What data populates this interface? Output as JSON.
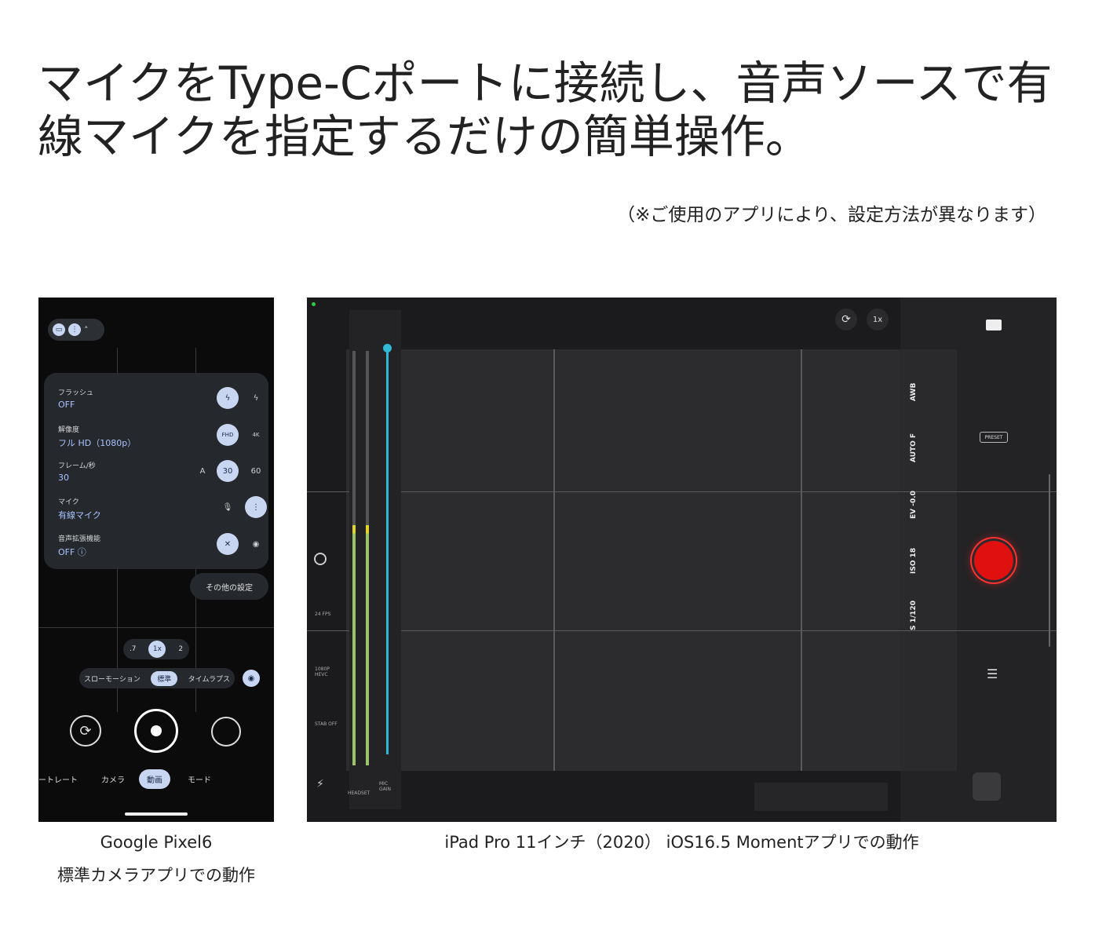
{
  "headline": "マイクをType-Cポートに接続し、音声ソースで有線マイクを指定するだけの簡単操作。",
  "note": "（※ご使用のアプリにより、設定方法が異なります）",
  "captions": {
    "pixel_line1": "Google Pixel6",
    "pixel_line2": "標準カメラアプリでの動作",
    "ipad": "iPad Pro 11インチ（2020） iOS16.5 Momentアプリでの動作"
  },
  "pixel": {
    "settings": [
      {
        "label": "フラッシュ",
        "value": "OFF"
      },
      {
        "label": "解像度",
        "value": "フル HD（1080p）"
      },
      {
        "label": "フレーム/秒",
        "value": "30"
      },
      {
        "label": "マイク",
        "value": "有線マイク"
      },
      {
        "label": "音声拡張機能",
        "value": "OFF ⓘ"
      }
    ],
    "fps_options": [
      "A",
      "30",
      "60"
    ],
    "res_options": [
      "FHD",
      "4K"
    ],
    "more_settings": "その他の設定",
    "zoom": [
      ".7",
      "1x",
      "2"
    ],
    "modes": [
      "スローモーション",
      "標準",
      "タイムラプス"
    ],
    "tabs": [
      "ートレート",
      "カメラ",
      "動画",
      "モード"
    ]
  },
  "ipad": {
    "zoom": "1x",
    "right_labels": [
      "AWB",
      "AUTO F",
      "EV -0.0",
      "ISO 18",
      "S 1/120"
    ],
    "preset": "PRESET",
    "mic_label": "HEADSET",
    "gain_label": "MIC GAIN",
    "left_labels": [
      "24 FPS",
      "1080P HEVC",
      "STAB OFF"
    ]
  },
  "colors": {
    "accent": "#c9d6f2",
    "record": "#e01010",
    "fader": "#2fb9d6"
  }
}
